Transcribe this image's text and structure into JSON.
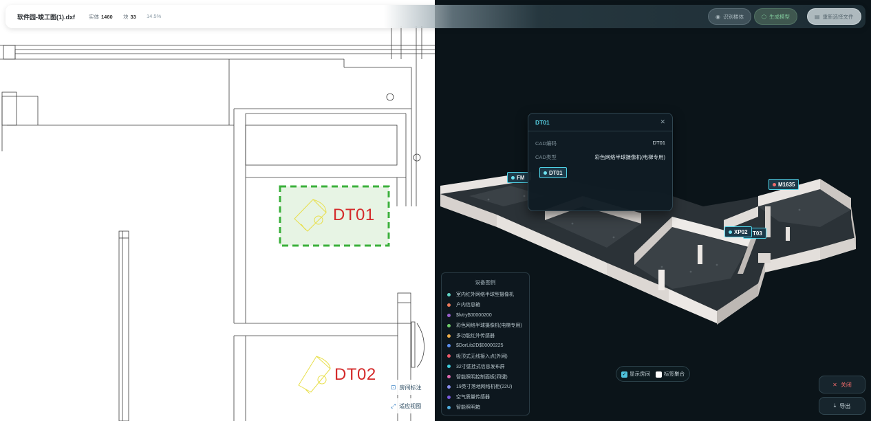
{
  "header": {
    "file_name": "软件园-竣工图(1).dxf",
    "entities_label": "实体",
    "entities_value": "1460",
    "blocks_label": "块",
    "blocks_value": "33",
    "zoom": "14.5%",
    "buttons": {
      "recognize": "识别楼体",
      "generate": "生成模型",
      "reselect": "重新选择文件"
    }
  },
  "cad": {
    "tags": [
      "DT01",
      "DT02"
    ],
    "tools": {
      "room_label": "房间标注",
      "fit_view": "适应视图"
    }
  },
  "scene": {
    "tags": [
      "FM",
      "DT01",
      "M1635",
      "XP02",
      "T03"
    ],
    "popup": {
      "title": "DT01",
      "rows": [
        {
          "key": "CAD编码",
          "value": "DT01"
        },
        {
          "key": "CAD类型",
          "value": "彩色网络半球摄像机(电梯专用)"
        }
      ],
      "chip": "DT01"
    },
    "legend": {
      "title": "设备图例",
      "items": [
        {
          "label": "室内红外网络半球型摄像机",
          "color": "#5fd3c6"
        },
        {
          "label": "户内信息箱",
          "color": "#ef7a5a"
        },
        {
          "label": "$lvtry$00000200",
          "color": "#9a5fd0"
        },
        {
          "label": "彩色网络半球摄像机(电梯专用)",
          "color": "#6fce6a"
        },
        {
          "label": "多功能红外传感器",
          "color": "#f0b04a"
        },
        {
          "label": "$DorLib2D$00000225",
          "color": "#5b8ff0"
        },
        {
          "label": "吸顶式无线接入点(外网)",
          "color": "#ef5a6a"
        },
        {
          "label": "32寸壁挂式信息发布屏",
          "color": "#3fd0e0"
        },
        {
          "label": "智能照明控制面板(四键)",
          "color": "#e06ab0"
        },
        {
          "label": "19英寸落地网络机柜(22U)",
          "color": "#8a8ff0"
        },
        {
          "label": "空气质量传感器",
          "color": "#7a5ae0"
        },
        {
          "label": "智能照明箱",
          "color": "#4faee0"
        }
      ]
    },
    "toggles": {
      "show_rooms": "显示房间",
      "show_rooms_checked": true,
      "label_merge": "标签聚合",
      "label_merge_checked": false
    },
    "buttons": {
      "close": "关闭",
      "export": "导出"
    }
  }
}
